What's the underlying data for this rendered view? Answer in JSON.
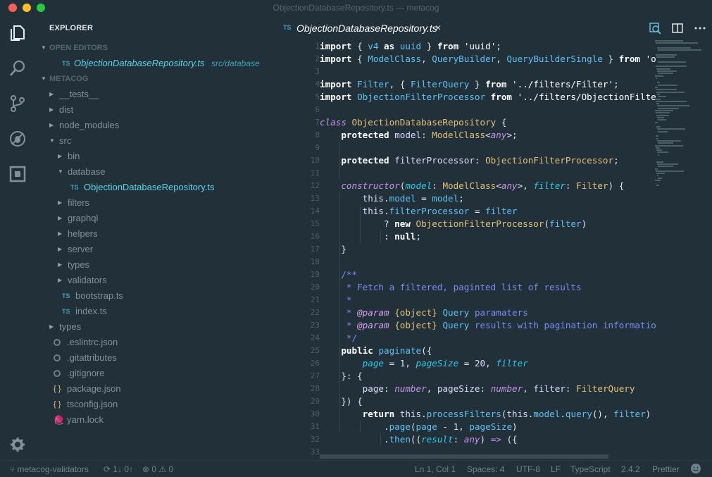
{
  "window": {
    "title": "ObjectionDatabaseRepository.ts — metacog"
  },
  "activity_bar": {
    "items": [
      "files-icon",
      "search-icon",
      "source-control-icon",
      "debug-icon",
      "extensions-icon"
    ],
    "bottom": "settings-gear-icon"
  },
  "explorer": {
    "title": "EXPLORER",
    "open_editors_header": "OPEN EDITORS",
    "open_editors": [
      {
        "icon": "TS",
        "name": "ObjectionDatabaseRepository.ts",
        "path": "src/database"
      }
    ],
    "project_header": "METACOG",
    "tree": [
      {
        "name": "__tests__",
        "type": "folder",
        "depth": 1
      },
      {
        "name": "dist",
        "type": "folder",
        "depth": 1
      },
      {
        "name": "node_modules",
        "type": "folder",
        "depth": 1
      },
      {
        "name": "src",
        "type": "folder-open",
        "depth": 1
      },
      {
        "name": "bin",
        "type": "folder",
        "depth": 2
      },
      {
        "name": "database",
        "type": "folder-open",
        "depth": 2
      },
      {
        "name": "ObjectionDatabaseRepository.ts",
        "type": "ts",
        "depth": 3,
        "active": true
      },
      {
        "name": "filters",
        "type": "folder",
        "depth": 2
      },
      {
        "name": "graphql",
        "type": "folder",
        "depth": 2
      },
      {
        "name": "helpers",
        "type": "folder",
        "depth": 2
      },
      {
        "name": "server",
        "type": "folder",
        "depth": 2
      },
      {
        "name": "types",
        "type": "folder",
        "depth": 2
      },
      {
        "name": "validators",
        "type": "folder",
        "depth": 2
      },
      {
        "name": "bootstrap.ts",
        "type": "ts",
        "depth": 2
      },
      {
        "name": "index.ts",
        "type": "ts",
        "depth": 2
      },
      {
        "name": "types",
        "type": "folder",
        "depth": 1
      },
      {
        "name": ".eslintrc.json",
        "type": "config",
        "depth": 1
      },
      {
        "name": ".gitattributes",
        "type": "config",
        "depth": 1
      },
      {
        "name": ".gitignore",
        "type": "config",
        "depth": 1
      },
      {
        "name": "package.json",
        "type": "json",
        "depth": 1
      },
      {
        "name": "tsconfig.json",
        "type": "json",
        "depth": 1
      },
      {
        "name": "yarn.lock",
        "type": "yarn",
        "depth": 1
      }
    ]
  },
  "editor": {
    "tab": {
      "icon": "TS",
      "name": "ObjectionDatabaseRepository.ts",
      "close": "×"
    },
    "toolbar_icons": [
      "open-changes-icon",
      "split-editor-icon",
      "more-actions-icon"
    ],
    "line_numbers": [
      "1",
      "2",
      "3",
      "4",
      "5",
      "6",
      "7",
      "8",
      "9",
      "10",
      "11",
      "12",
      "13",
      "14",
      "15",
      "16",
      "17",
      "18",
      "19",
      "20",
      "21",
      "22",
      "23",
      "24",
      "25",
      "26",
      "27",
      "28",
      "29",
      "30",
      "31",
      "32",
      "33"
    ]
  },
  "status": {
    "branch": "metacog-validators",
    "sync": "1↓ 0↑",
    "errors": "0",
    "warnings": "0",
    "position": "Ln 1, Col 1",
    "spaces": "Spaces: 4",
    "encoding": "UTF-8",
    "eol": "LF",
    "language": "TypeScript",
    "ts_version": "2.4.2",
    "formatter": "Prettier",
    "feedback_icon": "smiley-icon"
  }
}
